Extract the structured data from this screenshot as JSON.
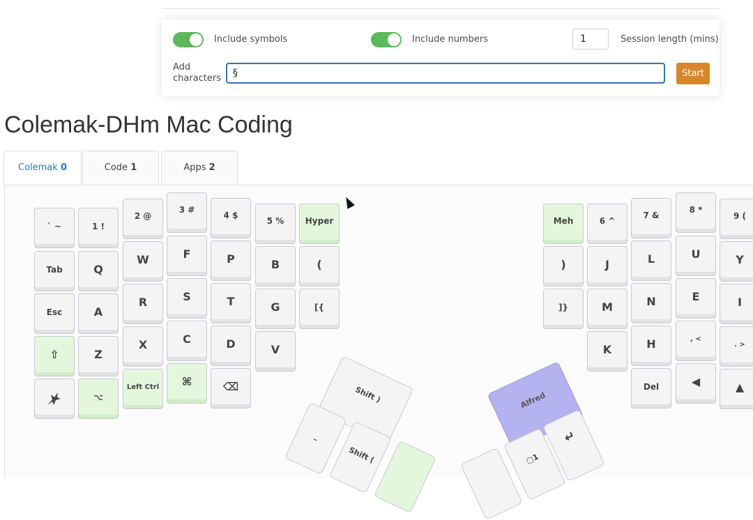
{
  "settings": {
    "symbols": {
      "label": "Include symbols",
      "on": true
    },
    "numbers": {
      "label": "Include numbers",
      "on": true
    },
    "session": {
      "value": "1",
      "label": "Session length (mins)"
    },
    "add_chars": {
      "label_line1": "Add",
      "label_line2": "characters",
      "value": "§"
    },
    "start_label": "Start"
  },
  "title": "Colemak-DHm Mac Coding",
  "tabs": [
    {
      "name": "Colemak",
      "num": "0",
      "active": true
    },
    {
      "name": "Code",
      "num": "1",
      "active": false
    },
    {
      "name": "Apps",
      "num": "2",
      "active": false
    }
  ],
  "left_keys": {
    "backtick": "` ~",
    "one": "1 !",
    "two": "2 @",
    "three": "3 #",
    "four": "4 $",
    "five": "5 %",
    "hyper": "Hyper",
    "tab": "Tab",
    "q": "Q",
    "w": "W",
    "f": "F",
    "p": "P",
    "b": "B",
    "paren_open": "(",
    "esc": "Esc",
    "a": "A",
    "r": "R",
    "s": "S",
    "t": "T",
    "g": "G",
    "bracket_open": "[{",
    "shift": "⇧",
    "z": "Z",
    "x": "X",
    "c": "C",
    "d": "D",
    "v": "V",
    "alt": "⌥",
    "left_ctrl": "Left Ctrl",
    "cmd": "⌘",
    "backspace": "⌫",
    "shift_paren_close": "Shift )",
    "shift_paren_open": "Shift (",
    "underscore": "_"
  },
  "right_keys": {
    "meh": "Meh",
    "six": "6 ^",
    "seven": "7 &",
    "eight": "8 *",
    "nine": "9 (",
    "paren_close": ")",
    "j": "J",
    "l": "L",
    "u": "U",
    "y": "Y",
    "bracket_close": "]}",
    "m": "M",
    "n": "N",
    "e": "E",
    "i": "I",
    "k": "K",
    "h": "H",
    "comma": ", <",
    "period": ". >",
    "del": "Del",
    "left_arrow": "◀",
    "up_arrow": "▲",
    "alfred": "Alfred",
    "enter": "↵",
    "layer_one": "▢1"
  },
  "colors": {
    "accent": "#2f72b8",
    "start": "#d8862a",
    "toggle": "#5cb85c",
    "green_key": "#e4f7dc",
    "alfred": "#b5b2f0"
  }
}
